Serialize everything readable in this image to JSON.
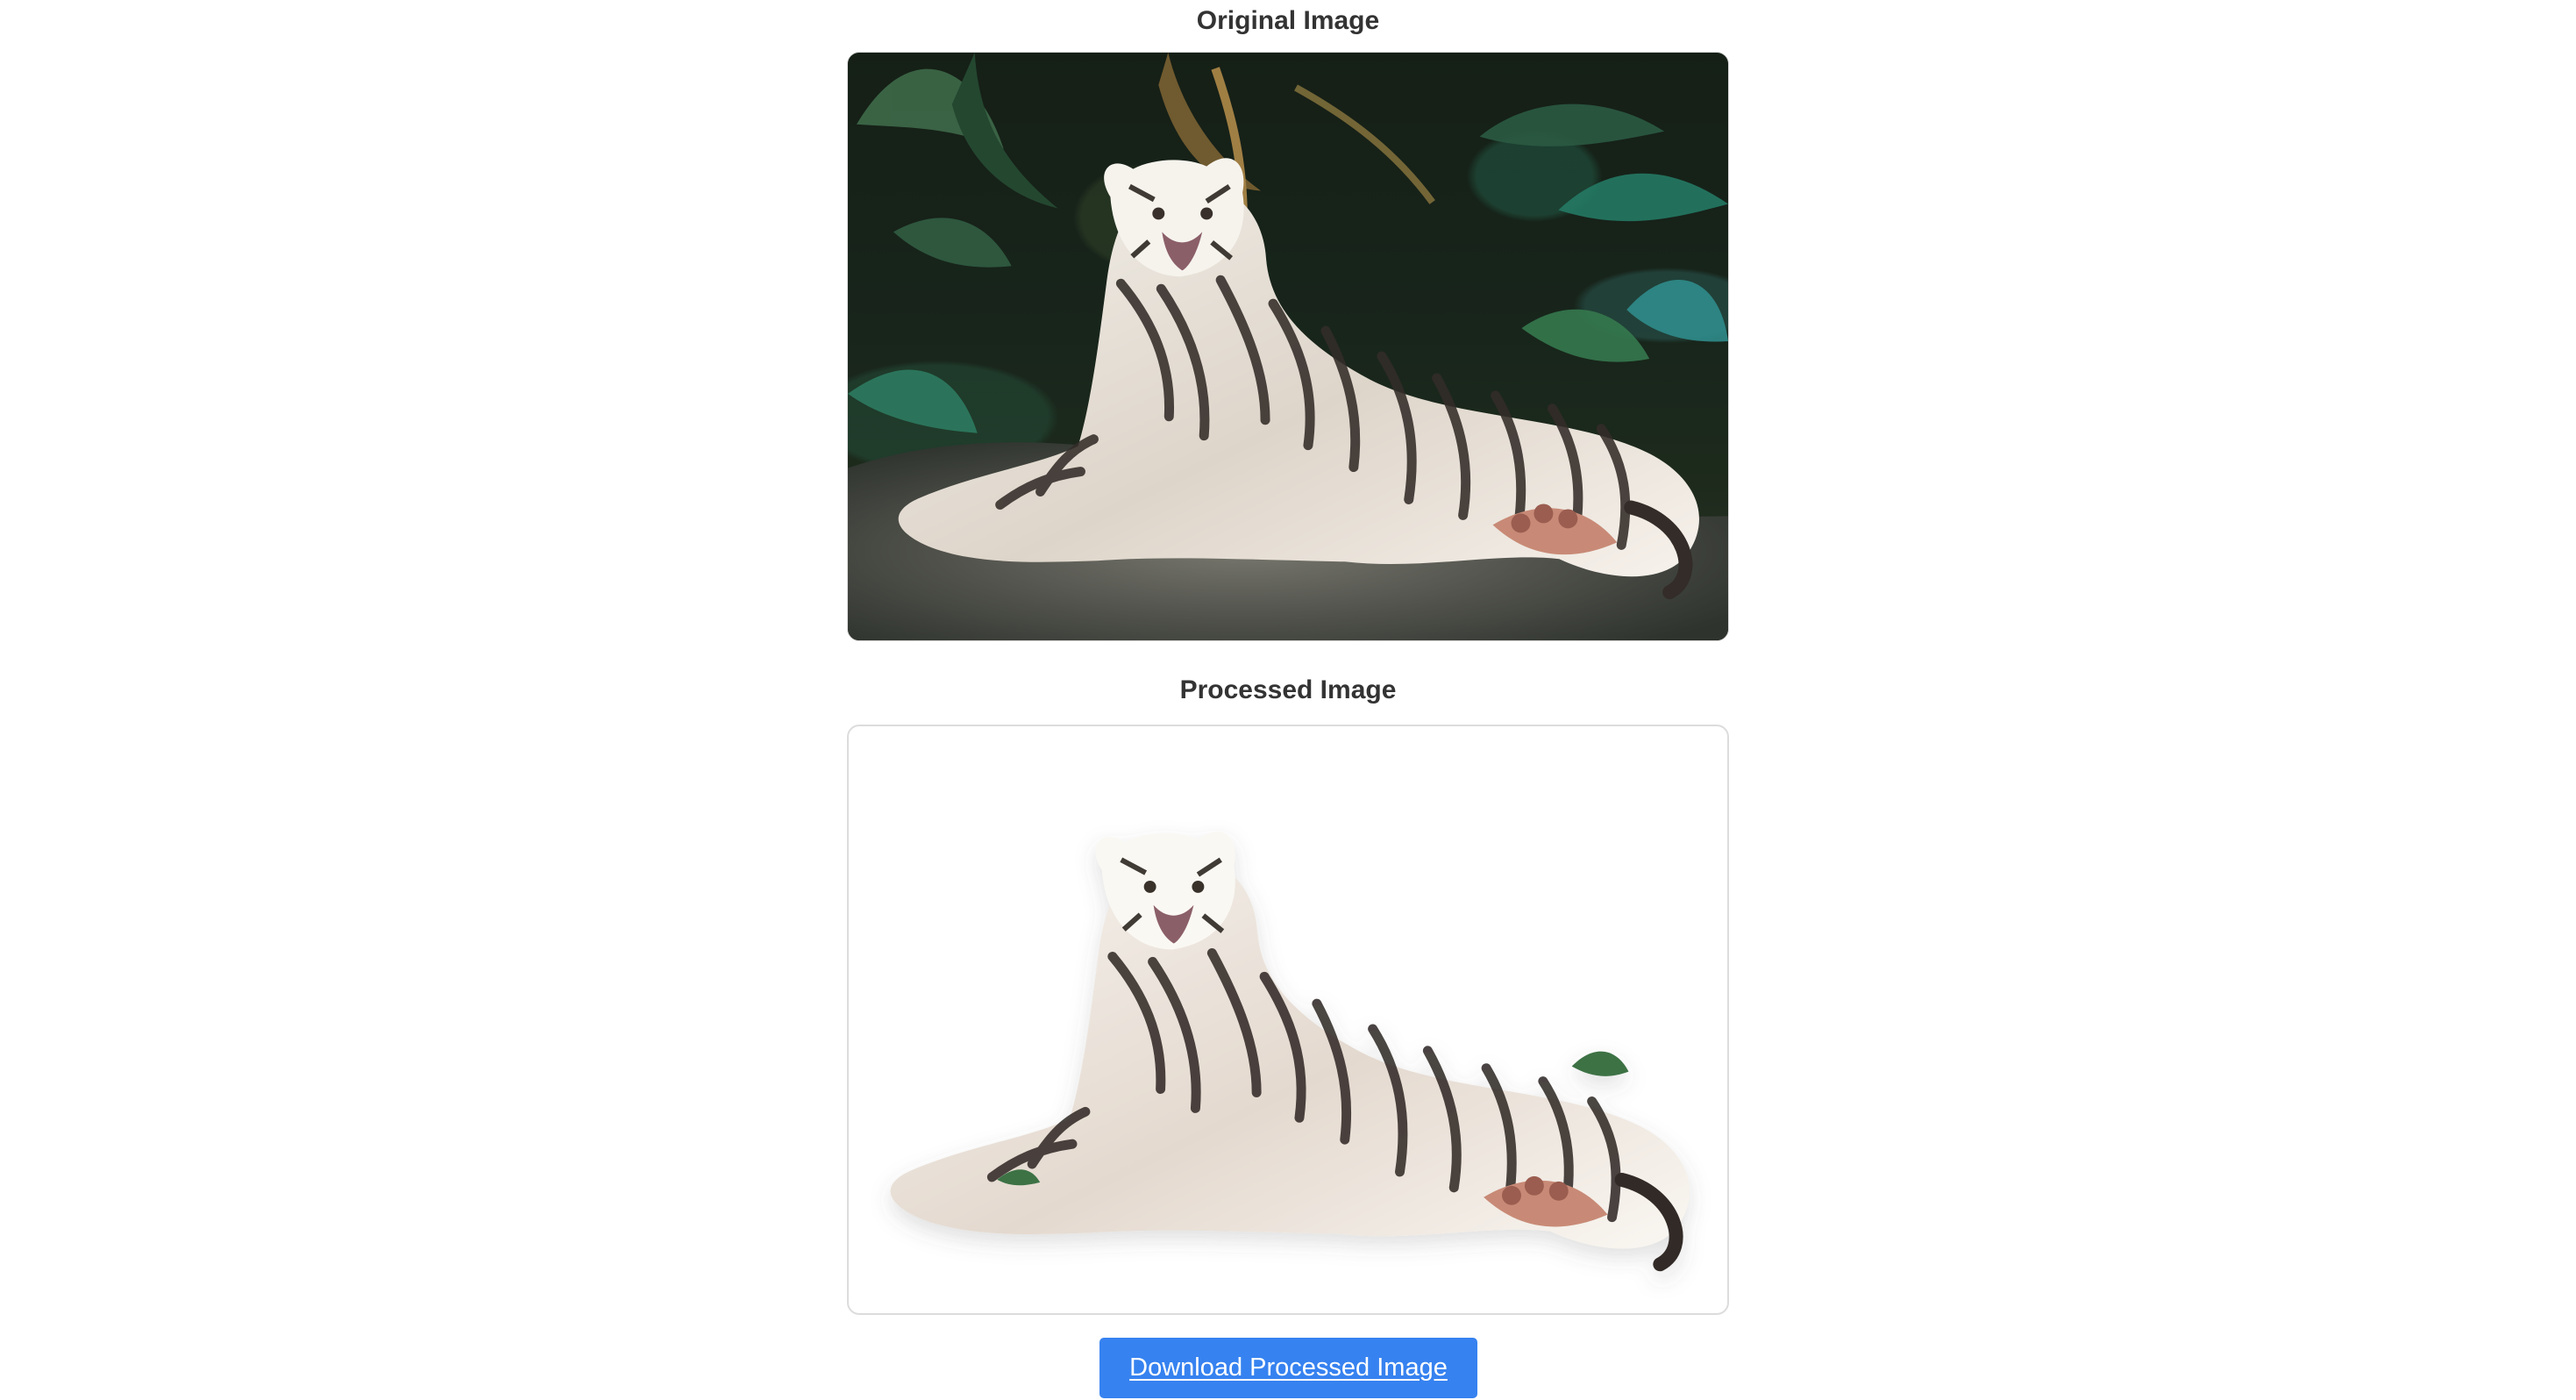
{
  "page": {
    "original_title": "Original Image",
    "processed_title": "Processed Image",
    "download_label": "Download Processed Image"
  },
  "images": {
    "original_alt": "White tiger lying among jungle plants",
    "processed_alt": "White tiger with background removed"
  },
  "colors": {
    "button": "#3682f0",
    "processed_border": "#dcdcdc",
    "title_text": "#333333"
  }
}
